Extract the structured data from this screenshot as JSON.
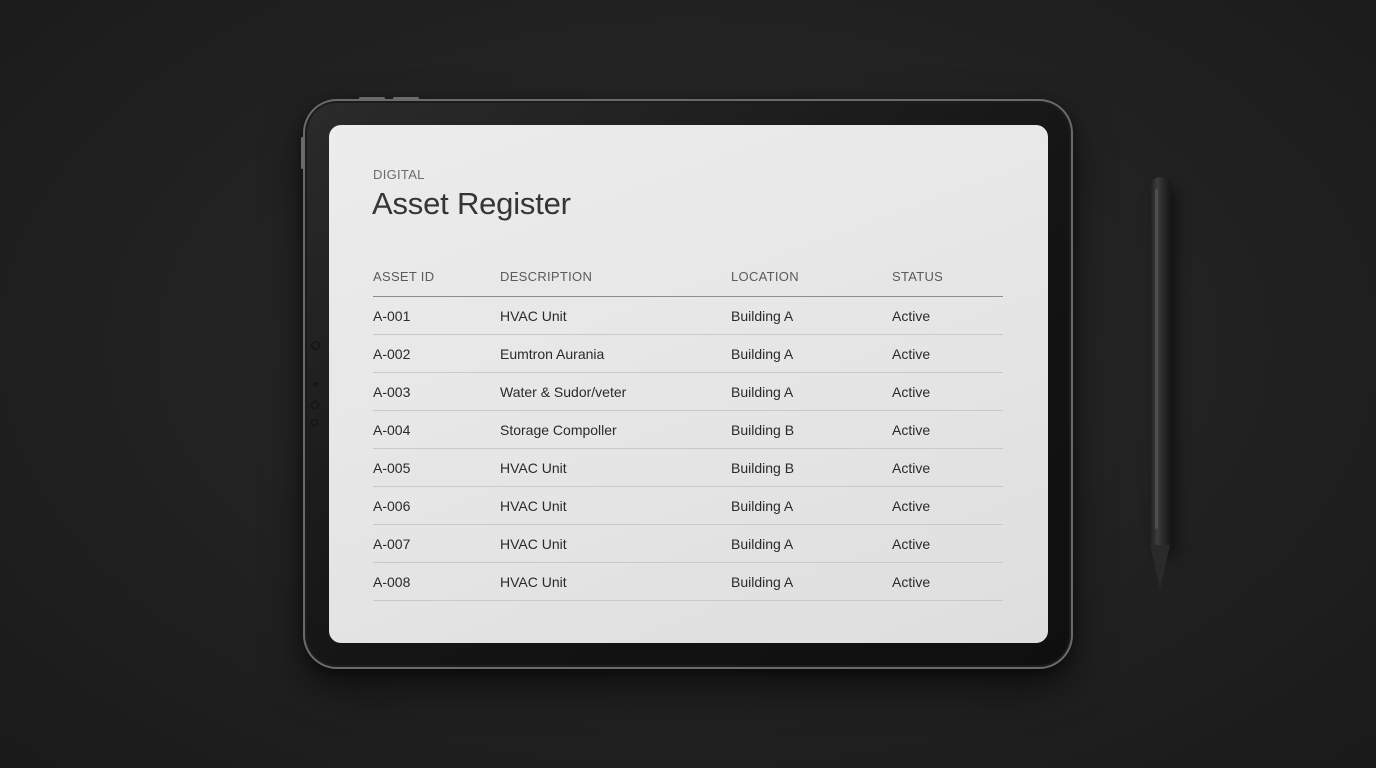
{
  "page": {
    "eyebrow": "DIGITAL",
    "title": "Asset Register"
  },
  "table": {
    "columns": [
      "ASSET ID",
      "DESCRIPTION",
      "LOCATION",
      "STATUS"
    ],
    "rows": [
      [
        "A-001",
        "HVAC Unit",
        "Building A",
        "Active"
      ],
      [
        "A-002",
        "Eumtron Aurania",
        "Building A",
        "Active"
      ],
      [
        "A-003",
        "Water & Sudor/veter",
        "Building A",
        "Active"
      ],
      [
        "A-004",
        "Storage Compoller",
        "Building B",
        "Active"
      ],
      [
        "A-005",
        "HVAC Unit",
        "Building B",
        "Active"
      ],
      [
        "A-006",
        "HVAC Unit",
        "Building A",
        "Active"
      ],
      [
        "A-007",
        "HVAC Unit",
        "Building A",
        "Active"
      ],
      [
        "A-008",
        "HVAC Unit",
        "Building A",
        "Active"
      ]
    ]
  },
  "colors": {
    "background": "#232323",
    "screen": "#e8e8e8",
    "text": "#2a2a2a",
    "header_text": "#5b5b5b"
  }
}
